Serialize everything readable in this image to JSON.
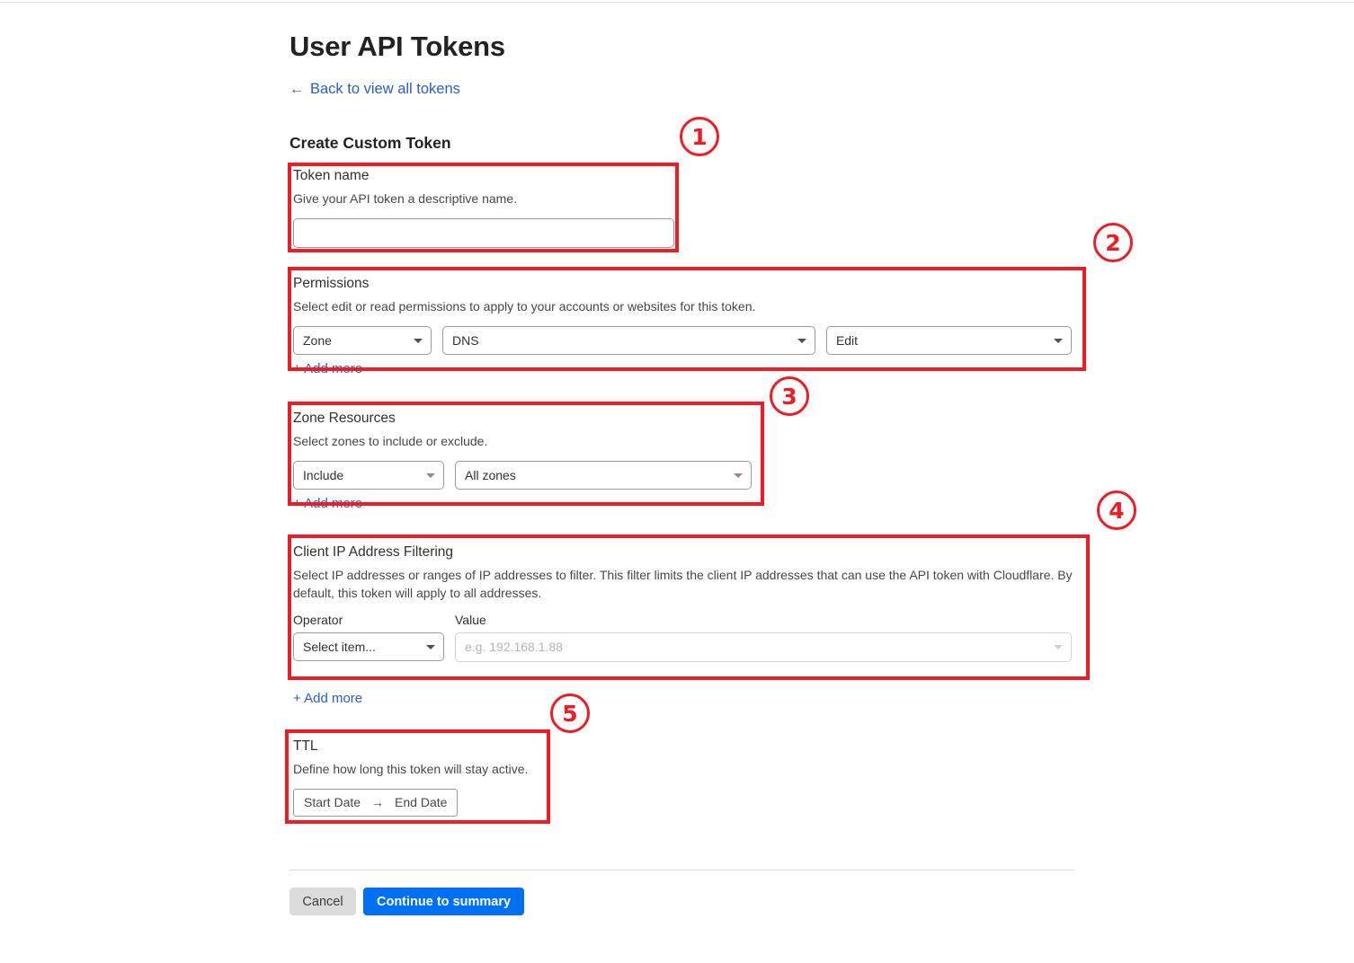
{
  "page": {
    "title": "User API Tokens",
    "back_link": "Back to view all tokens",
    "back_arrow": "←",
    "section_title": "Create Custom Token"
  },
  "token_name": {
    "label": "Token name",
    "description": "Give your API token a descriptive name.",
    "value": "",
    "placeholder": ""
  },
  "permissions": {
    "label": "Permissions",
    "description": "Select edit or read permissions to apply to your accounts or websites for this token.",
    "scope": "Zone",
    "resource": "DNS",
    "access": "Edit",
    "add_more": "+ Add more"
  },
  "zone_resources": {
    "label": "Zone Resources",
    "description": "Select zones to include or exclude.",
    "mode": "Include",
    "zones": "All zones",
    "add_more": "+ Add more"
  },
  "ip_filtering": {
    "label": "Client IP Address Filtering",
    "description": "Select IP addresses or ranges of IP addresses to filter. This filter limits the client IP addresses that can use the API token with Cloudflare. By default, this token will apply to all addresses.",
    "operator_label": "Operator",
    "value_label": "Value",
    "operator_value": "Select item...",
    "value_placeholder": "e.g. 192.168.1.88",
    "value_value": "",
    "add_more": "+ Add more"
  },
  "ttl": {
    "label": "TTL",
    "description": "Define how long this token will stay active.",
    "start_date": "Start Date",
    "end_date": "End Date",
    "range_arrow": "→"
  },
  "footer": {
    "cancel_label": "Cancel",
    "continue_label": "Continue to summary"
  },
  "annotations": {
    "badges": [
      "1",
      "2",
      "3",
      "4",
      "5"
    ],
    "color": "#ee1c25"
  },
  "colors": {
    "primary_button": "#0070f3",
    "link": "#2c5cc5",
    "annotation": "#ee1c25",
    "cancel_button": "#dcdcdc"
  }
}
